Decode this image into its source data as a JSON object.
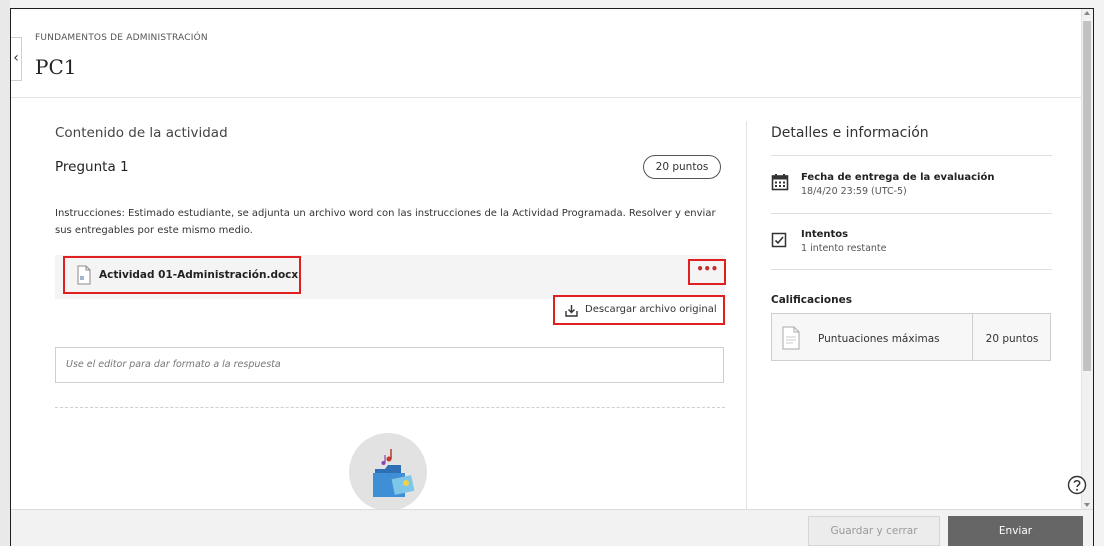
{
  "header": {
    "course_name": "FUNDAMENTOS DE ADMINISTRACIÓN",
    "title": "PC1",
    "back_label": "‹"
  },
  "main": {
    "section_title": "Contenido de la actividad",
    "question_title": "Pregunta 1",
    "points_badge": "20 puntos",
    "instructions": "Instrucciones: Estimado estudiante, se adjunta un archivo word con las instrucciones de la Actividad Programada. Resolver y enviar sus entregables por este mismo medio.",
    "attachment": {
      "file_name": "Actividad 01-Administración.docx",
      "more_label": "•••",
      "download_label": "Descargar archivo original",
      "icon": "document-icon"
    },
    "editor_placeholder": "Use el editor para dar formato a la respuesta"
  },
  "sidebar": {
    "title": "Detalles e información",
    "due": {
      "title": "Fecha de entrega de la evaluación",
      "value": "18/4/20 23:59 (UTC-5)",
      "icon": "calendar-icon"
    },
    "attempts": {
      "title": "Intentos",
      "value": "1 intento restante",
      "icon": "checkbox-icon"
    },
    "grades_title": "Calificaciones",
    "score": {
      "label": "Puntuaciones máximas",
      "value": "20 puntos"
    }
  },
  "footer": {
    "save_label": "Guardar y cerrar",
    "submit_label": "Enviar"
  },
  "colors": {
    "highlight": "#e02020",
    "submit_bg": "#666666",
    "accent_dots": "#c4302b"
  }
}
